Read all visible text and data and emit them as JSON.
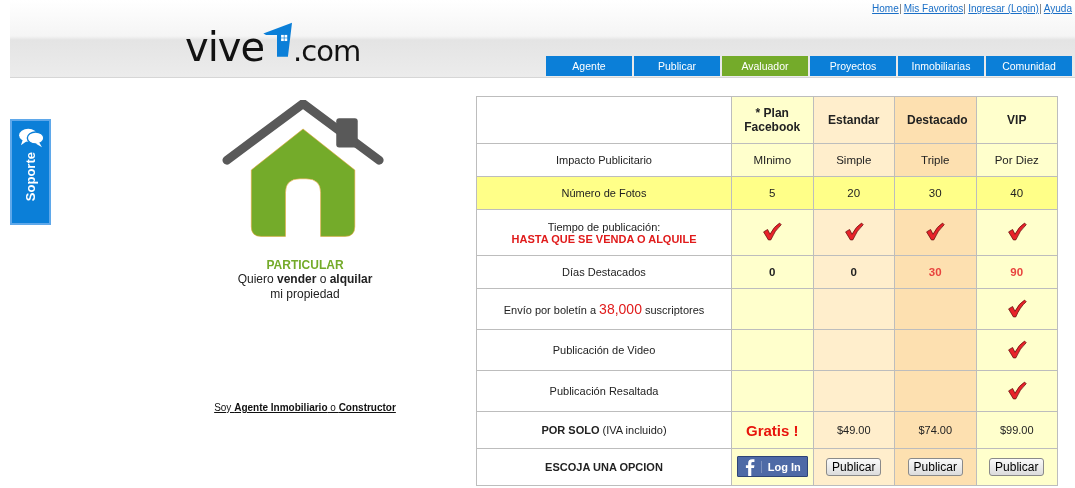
{
  "header": {
    "logo": {
      "left": "vive",
      "right": ".com"
    },
    "top_links": [
      "Home",
      "Mis Favoritos",
      "Ingresar (Login)",
      "Ayuda"
    ],
    "nav": [
      {
        "label": "Agente",
        "selected": false
      },
      {
        "label": "Publicar",
        "selected": false
      },
      {
        "label": "Avaluador",
        "selected": true
      },
      {
        "label": "Proyectos",
        "selected": false
      },
      {
        "label": "Inmobiliarias",
        "selected": false
      },
      {
        "label": "Comunidad",
        "selected": false
      }
    ]
  },
  "support_tab": {
    "label": "Soporte"
  },
  "owner_panel": {
    "title": "PARTICULAR",
    "text": "Quiero **vender** o **alquilar**",
    "subtext": "mi propiedad",
    "agent_link": "Soy **Agente Inmobiliario** o **Constructor**"
  },
  "plans_table": {
    "columns": [
      {
        "label": "* Plan Facebook",
        "color": "#ffffcc"
      },
      {
        "label": "Estandar",
        "color": "#ffeecc"
      },
      {
        "label": "Destacado",
        "color": "#fde0b0"
      },
      {
        "label": "VIP",
        "color": "#ffffcc"
      }
    ],
    "rows": [
      {
        "label": [
          {
            "kind": "plain",
            "text": "Impacto Publicitario"
          }
        ],
        "highlighted": false,
        "cells": [
          {
            "kind": "text",
            "text": "MInimo"
          },
          {
            "kind": "text",
            "text": "Simple"
          },
          {
            "kind": "text",
            "text": "Triple"
          },
          {
            "kind": "text",
            "text": "Por Diez"
          }
        ]
      },
      {
        "label": [
          {
            "kind": "plain",
            "text": "Número de Fotos"
          }
        ],
        "highlighted": true,
        "cells": [
          {
            "kind": "text",
            "text": "5"
          },
          {
            "kind": "text",
            "text": "20"
          },
          {
            "kind": "text",
            "text": "30"
          },
          {
            "kind": "text",
            "text": "40"
          }
        ]
      },
      {
        "label": [
          {
            "kind": "plain",
            "text": "Tiempo de publicación:"
          }
        ],
        "note": "HASTA QUE SE VENDA O ALQUILE",
        "highlighted": false,
        "cells": [
          {
            "kind": "check"
          },
          {
            "kind": "check"
          },
          {
            "kind": "check"
          },
          {
            "kind": "check"
          }
        ]
      },
      {
        "label": [
          {
            "kind": "plain",
            "text": "Días Destacados"
          }
        ],
        "highlighted": false,
        "cells": [
          {
            "kind": "strong",
            "text": "0"
          },
          {
            "kind": "strong",
            "text": "0"
          },
          {
            "kind": "accent",
            "text": "30"
          },
          {
            "kind": "accent",
            "text": "90"
          }
        ]
      },
      {
        "label": [
          {
            "kind": "plain",
            "text": "Envío por boletín a "
          },
          {
            "kind": "accent",
            "text": "38,000"
          },
          {
            "kind": "plain",
            "text": " suscriptores"
          }
        ],
        "highlighted": false,
        "cells": [
          {
            "kind": "empty"
          },
          {
            "kind": "empty"
          },
          {
            "kind": "empty"
          },
          {
            "kind": "check"
          }
        ]
      },
      {
        "label": [
          {
            "kind": "plain",
            "text": "Publicación de Video"
          }
        ],
        "highlighted": false,
        "cells": [
          {
            "kind": "empty"
          },
          {
            "kind": "empty"
          },
          {
            "kind": "empty"
          },
          {
            "kind": "check"
          }
        ]
      },
      {
        "label": [
          {
            "kind": "plain",
            "text": "Publicación Resaltada"
          }
        ],
        "highlighted": false,
        "cells": [
          {
            "kind": "empty"
          },
          {
            "kind": "empty"
          },
          {
            "kind": "empty"
          },
          {
            "kind": "check"
          }
        ]
      },
      {
        "label": [
          {
            "kind": "rich",
            "text": "**POR SOLO** (IVA incluido)"
          }
        ],
        "highlighted": false,
        "cells": [
          {
            "kind": "free",
            "text": "Gratis !"
          },
          {
            "kind": "price",
            "text": "$49.00"
          },
          {
            "kind": "price",
            "text": "$74.00"
          },
          {
            "kind": "price",
            "text": "$99.00"
          }
        ]
      },
      {
        "label": [
          {
            "kind": "bold",
            "text": "ESCOJA UNA OPCION"
          }
        ],
        "highlighted": false,
        "cells": [
          {
            "kind": "facebook",
            "text": "Log In"
          },
          {
            "kind": "button",
            "text": "Publicar"
          },
          {
            "kind": "button",
            "text": "Publicar"
          },
          {
            "kind": "button",
            "text": "Publicar"
          }
        ]
      }
    ]
  }
}
